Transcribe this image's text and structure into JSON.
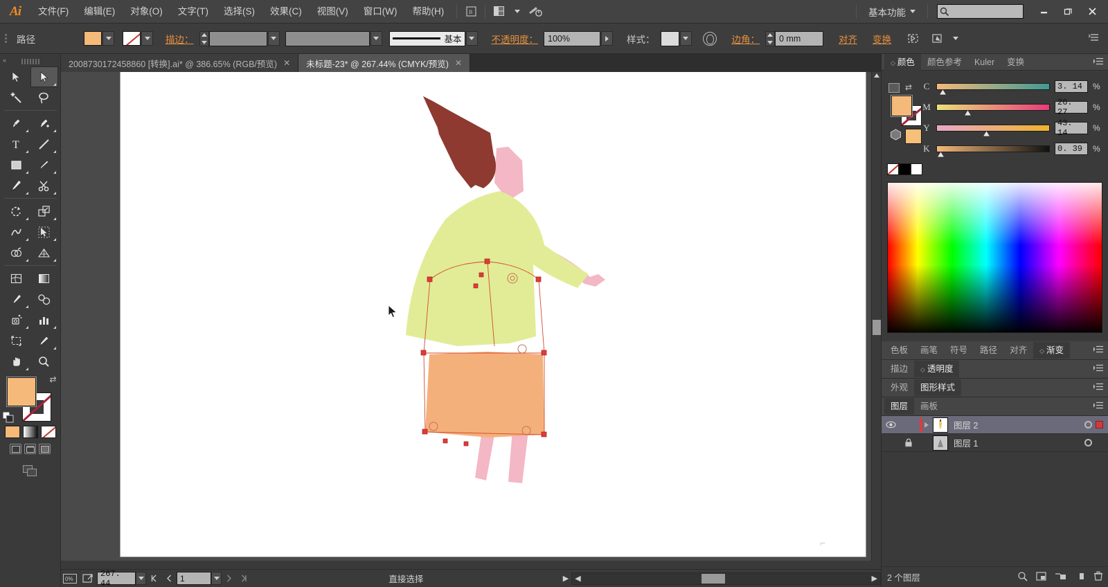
{
  "app": {
    "logo": "Ai"
  },
  "menubar": {
    "items": [
      {
        "label": "文件(F)"
      },
      {
        "label": "编辑(E)"
      },
      {
        "label": "对象(O)"
      },
      {
        "label": "文字(T)"
      },
      {
        "label": "选择(S)"
      },
      {
        "label": "效果(C)"
      },
      {
        "label": "视图(V)"
      },
      {
        "label": "窗口(W)"
      },
      {
        "label": "帮助(H)"
      }
    ],
    "bridge_icon": "bridge-icon",
    "arrange_icon": "arrange-documents-icon",
    "flash_icon": "device-central-icon",
    "workspace": "基本功能",
    "search_placeholder": "",
    "window_controls": {
      "minimize": "—",
      "restore": "❐",
      "close": "✕"
    }
  },
  "optionsbar": {
    "selection_type": "路径",
    "fill_swatch_color": "#f5b97a",
    "stroke_label": "描边：",
    "stroke_weight": "",
    "stroke_profile": "",
    "brush_label": "基本",
    "opacity_label": "不透明度：",
    "opacity_value": "100%",
    "style_label": "样式：",
    "corner_label": "边角：",
    "corner_value": "0 mm",
    "align_label": "对齐",
    "transform_label": "变换",
    "isolate_icon": "isolate-selected-object-icon",
    "draw_mode_icon": "draw-mode-icon",
    "panel_menu_icon": "panel-menu-icon"
  },
  "tabs": [
    {
      "label": "2008730172458860 [转换].ai* @ 386.65% (RGB/预览)",
      "active": false,
      "close": "✕"
    },
    {
      "label": "未标题-23* @ 267.44% (CMYK/预览)",
      "active": true,
      "close": "✕"
    }
  ],
  "toolbar": {
    "tools": [
      {
        "name": "selection-tool",
        "active": false
      },
      {
        "name": "direct-selection-tool",
        "active": true
      },
      {
        "name": "magic-wand-tool",
        "active": false
      },
      {
        "name": "lasso-tool",
        "active": false
      },
      {
        "name": "pen-tool",
        "active": false
      },
      {
        "name": "add-anchor-point-tool",
        "active": false
      },
      {
        "name": "type-tool",
        "active": false
      },
      {
        "name": "line-segment-tool",
        "active": false
      },
      {
        "name": "rectangle-tool",
        "active": false
      },
      {
        "name": "paintbrush-tool",
        "active": false
      },
      {
        "name": "blob-brush-tool",
        "active": false
      },
      {
        "name": "eraser-scissors-tool",
        "active": false
      },
      {
        "name": "rotate-tool",
        "active": false
      },
      {
        "name": "scale-reflect-tool",
        "active": false
      },
      {
        "name": "width-warp-tool",
        "active": false
      },
      {
        "name": "free-transform-tool",
        "active": false
      },
      {
        "name": "shape-builder-tool",
        "active": false
      },
      {
        "name": "perspective-grid-tool",
        "active": false
      },
      {
        "name": "mesh-tool",
        "active": false
      },
      {
        "name": "gradient-tool",
        "active": false
      },
      {
        "name": "eyedropper-tool",
        "active": false
      },
      {
        "name": "blend-tool",
        "active": false
      },
      {
        "name": "symbol-sprayer-tool",
        "active": false
      },
      {
        "name": "column-graph-tool",
        "active": false
      },
      {
        "name": "artboard-tool",
        "active": false
      },
      {
        "name": "slice-tool",
        "active": false
      },
      {
        "name": "hand-tool",
        "active": false
      },
      {
        "name": "zoom-tool",
        "active": false
      }
    ],
    "fill_color": "#f5b97a",
    "stroke_color": "none"
  },
  "artwork": {
    "description": "character-illustration",
    "colors": {
      "hair": "#8e3a31",
      "skin": "#f3b7c6",
      "top": "#e2ec96",
      "skirt": "#f4b07a",
      "anchor": "#e03a3a"
    },
    "selected_object": "skirt-path"
  },
  "color_panel": {
    "tabs": [
      {
        "label": "颜色",
        "active": true,
        "diamond": "◇"
      },
      {
        "label": "颜色参考",
        "active": false
      },
      {
        "label": "Kuler",
        "active": false
      },
      {
        "label": "变换",
        "active": false
      }
    ],
    "sliders": [
      {
        "label": "C",
        "value": "3. 14",
        "unit": "%",
        "pos": 3.14
      },
      {
        "label": "M",
        "value": "26. 27",
        "unit": "%",
        "pos": 26.27
      },
      {
        "label": "Y",
        "value": "43. 14",
        "unit": "%",
        "pos": 43.14
      },
      {
        "label": "K",
        "value": "0. 39",
        "unit": "%",
        "pos": 0.39
      }
    ],
    "quick_swatches": [
      "none",
      "#000000",
      "#ffffff"
    ]
  },
  "panel_rows": [
    {
      "tabs": [
        {
          "label": "色板",
          "active": false
        },
        {
          "label": "画笔",
          "active": false
        },
        {
          "label": "符号",
          "active": false
        },
        {
          "label": "路径",
          "active": false
        },
        {
          "label": "对齐",
          "active": false
        },
        {
          "label": "渐变",
          "active": true,
          "diamond": "◇"
        }
      ]
    },
    {
      "tabs": [
        {
          "label": "描边",
          "active": false
        },
        {
          "label": "透明度",
          "active": true,
          "diamond": "◇"
        }
      ]
    },
    {
      "tabs": [
        {
          "label": "外观",
          "active": false
        },
        {
          "label": "图形样式",
          "active": true
        }
      ]
    },
    {
      "tabs": [
        {
          "label": "图层",
          "active": true
        },
        {
          "label": "画板",
          "active": false
        }
      ]
    }
  ],
  "layers": {
    "rows": [
      {
        "name": "图层 2",
        "selected": true,
        "visible": true,
        "locked": false,
        "has_children": true
      },
      {
        "name": "图层 1",
        "selected": false,
        "visible": false,
        "locked": true,
        "has_children": false
      }
    ],
    "footer_count": "2 个图层",
    "footer_icons": [
      "locate-object-icon",
      "make-clipping-mask-icon",
      "create-new-sublayer-icon",
      "create-new-layer-icon",
      "delete-selection-icon"
    ]
  },
  "statusbar": {
    "artboard_icon": "artboard-navigation-icon",
    "export_icon": "export-icon",
    "zoom_value": "267. 44",
    "page_value": "1",
    "status_text": "直接选择"
  }
}
